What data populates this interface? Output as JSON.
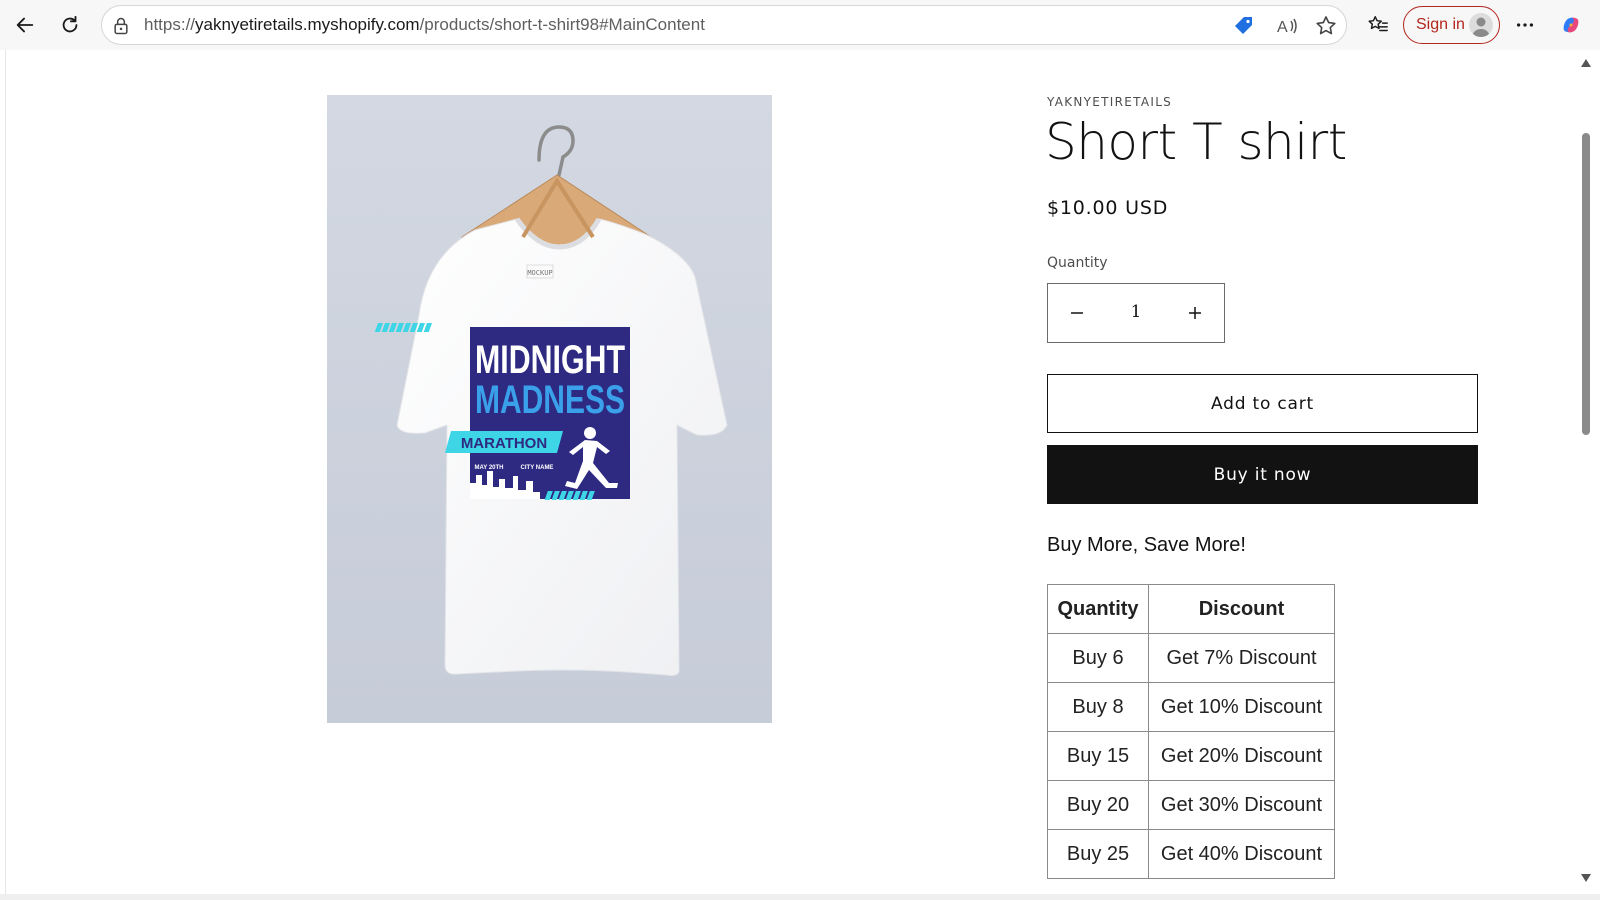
{
  "browser": {
    "url_scheme": "https://",
    "url_host": "yaknyetiretails.myshopify.com",
    "url_path": "/products/short-t-shirt98#MainContent",
    "signin_label": "Sign in",
    "icons": [
      "back-icon",
      "refresh-icon",
      "lock-icon",
      "tag-icon",
      "read-aloud-icon",
      "star-icon",
      "favorites-icon",
      "more-icon",
      "copilot-icon"
    ]
  },
  "product": {
    "vendor": "YAKNYETIRETAILS",
    "title": "Short T shirt",
    "price": "$10.00 USD",
    "quantity_label": "Quantity",
    "quantity_value": "1",
    "minus": "−",
    "plus": "+",
    "add_to_cart": "Add to cart",
    "buy_now": "Buy it now",
    "promo": "Buy More, Save More!",
    "shirt_print": {
      "line1": "MIDNIGHT",
      "line2": "MADNESS",
      "banner": "MARATHON",
      "date": "MAY 20TH",
      "city": "CITY NAME",
      "tag": "MOCKUP"
    }
  },
  "discount_table": {
    "headers": [
      "Quantity",
      "Discount"
    ],
    "rows": [
      [
        "Buy 6",
        "Get 7% Discount"
      ],
      [
        "Buy 8",
        "Get 10% Discount"
      ],
      [
        "Buy 15",
        "Get 20% Discount"
      ],
      [
        "Buy 20",
        "Get 30% Discount"
      ],
      [
        "Buy 25",
        "Get 40% Discount"
      ]
    ]
  },
  "colors": {
    "accent_dark": "#121212",
    "signin_red": "#b3261e",
    "image_bg": "#cdd3df",
    "print_navy": "#2e2a82",
    "print_cyan": "#3ed6e6"
  }
}
